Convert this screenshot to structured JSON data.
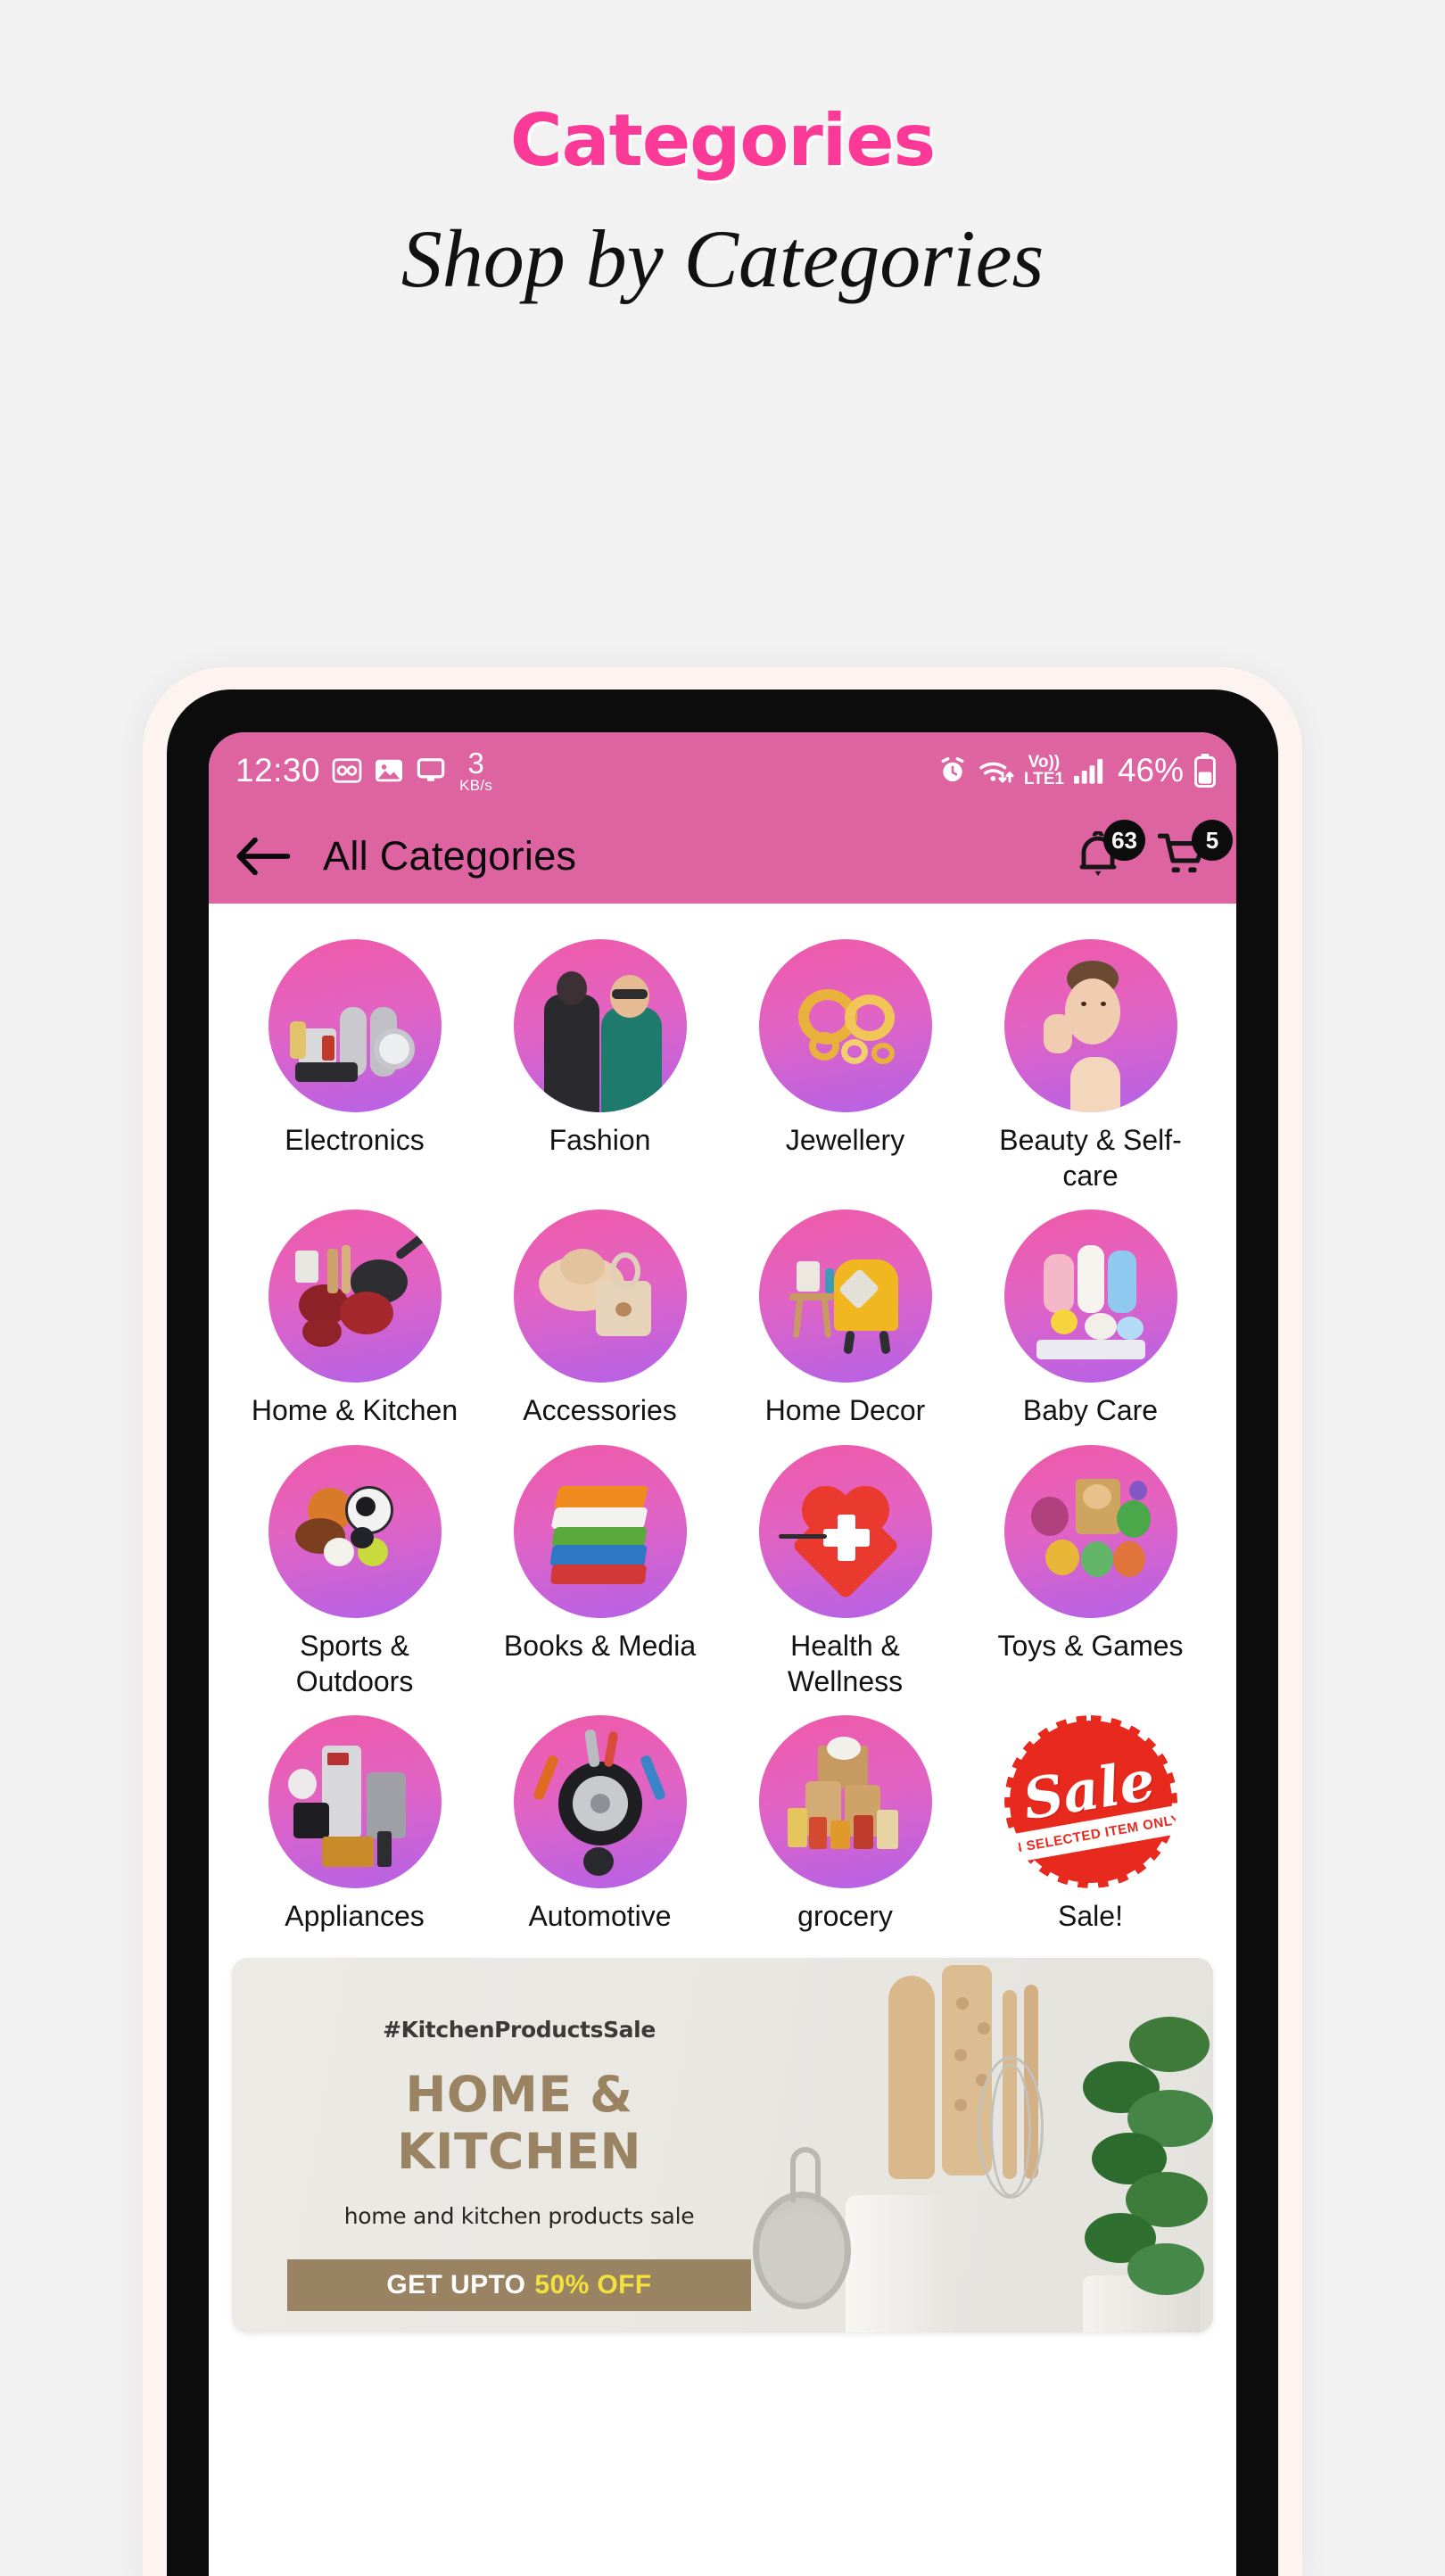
{
  "promo": {
    "title": "Categories",
    "subtitle": "Shop by Categories",
    "title_color": "#fa3a96",
    "page_bg": "#f2f2f2"
  },
  "phone": {
    "status_bar": {
      "time": "12:30",
      "network_speed_value": "3",
      "network_speed_unit": "KB/s",
      "volte_top": "Vo))",
      "volte_bottom": "LTE1",
      "battery_percent": "46%",
      "icons": [
        "voicemail-icon",
        "image-icon",
        "cast-screen-icon",
        "alarm-icon",
        "wifi-icon",
        "signal-bars-icon",
        "battery-icon"
      ]
    },
    "app_bar": {
      "title": "All Categories",
      "back_icon": "back-arrow-icon",
      "notification_icon": "bell-icon",
      "notification_badge": "63",
      "cart_icon": "shopping-cart-icon",
      "cart_badge": "5",
      "bar_color": "#dd64a1"
    },
    "categories": [
      {
        "label": "Electronics",
        "icon": "electronics-icon"
      },
      {
        "label": "Fashion",
        "icon": "fashion-icon"
      },
      {
        "label": "Jewellery",
        "icon": "jewellery-icon"
      },
      {
        "label": "Beauty & Self-care",
        "icon": "beauty-selfcare-icon"
      },
      {
        "label": "Home & Kitchen",
        "icon": "home-kitchen-icon"
      },
      {
        "label": "Accessories",
        "icon": "accessories-icon"
      },
      {
        "label": "Home Decor",
        "icon": "home-decor-icon"
      },
      {
        "label": "Baby Care",
        "icon": "baby-care-icon"
      },
      {
        "label": "Sports & Outdoors",
        "icon": "sports-outdoors-icon"
      },
      {
        "label": "Books & Media",
        "icon": "books-media-icon"
      },
      {
        "label": "Health & Wellness",
        "icon": "health-wellness-icon"
      },
      {
        "label": "Toys & Games",
        "icon": "toys-games-icon"
      },
      {
        "label": "Appliances",
        "icon": "appliances-icon"
      },
      {
        "label": "Automotive",
        "icon": "automotive-icon"
      },
      {
        "label": "grocery",
        "icon": "grocery-icon"
      },
      {
        "label": "Sale!",
        "icon": "sale-badge-icon"
      }
    ],
    "sale_sticker": {
      "word": "Sale",
      "band": "ON SELECTED ITEM ONLY",
      "color": "#e8291e"
    },
    "banner": {
      "hashtag": "#KitchenProductsSale",
      "headline": "HOME & KITCHEN",
      "subtext": "home and kitchen products sale",
      "cta_prefix": "GET UPTO",
      "cta_highlight": "50% OFF",
      "accent": "#9a8363",
      "highlight_color": "#f2e03c"
    }
  }
}
